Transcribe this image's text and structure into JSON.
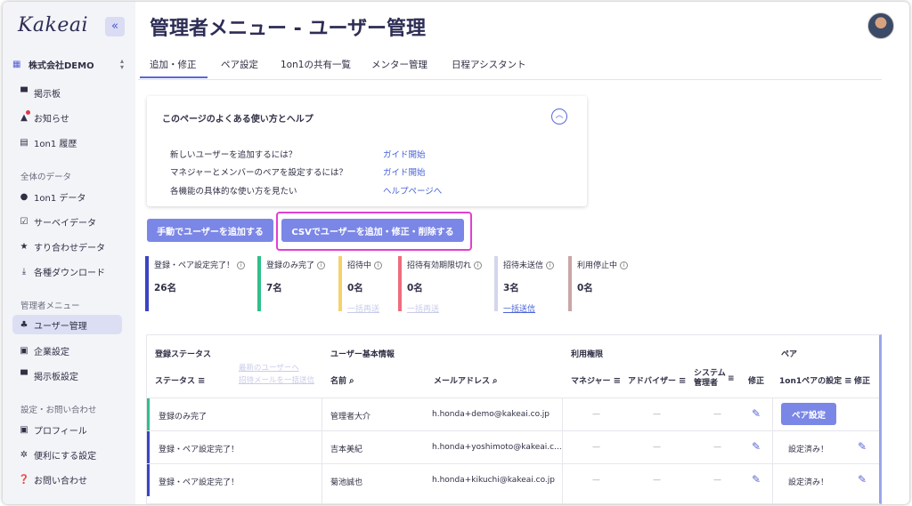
{
  "app": {
    "logo": "Kakeai",
    "collapse_icon": "«"
  },
  "sidebar": {
    "company": "株式会社DEMO",
    "items": [
      {
        "label": "掲示板",
        "icon": "board-icon"
      },
      {
        "label": "お知らせ",
        "icon": "bell-icon"
      },
      {
        "label": "1on1 履歴",
        "icon": "history-icon"
      }
    ],
    "sections": [
      {
        "title": "全体のデータ",
        "items": [
          {
            "label": "1on1 データ",
            "icon": "people-icon"
          },
          {
            "label": "サーベイデータ",
            "icon": "survey-icon"
          },
          {
            "label": "すり合わせデータ",
            "icon": "pin-icon"
          },
          {
            "label": "各種ダウンロード",
            "icon": "download-icon"
          }
        ]
      },
      {
        "title": "管理者メニュー",
        "items": [
          {
            "label": "ユーザー管理",
            "icon": "user-manage-icon",
            "active": true
          },
          {
            "label": "企業設定",
            "icon": "company-settings-icon"
          },
          {
            "label": "掲示板設定",
            "icon": "board-settings-icon"
          }
        ]
      },
      {
        "title": "設定・お問い合わせ",
        "items": [
          {
            "label": "プロフィール",
            "icon": "profile-icon"
          },
          {
            "label": "便利にする設定",
            "icon": "gear-icon"
          },
          {
            "label": "お問い合わせ",
            "icon": "help-icon"
          }
        ]
      }
    ]
  },
  "header": {
    "title": "管理者メニュー - ユーザー管理"
  },
  "tabs": [
    {
      "label": "追加・修正",
      "active": true
    },
    {
      "label": "ペア設定"
    },
    {
      "label": "1on1の共有一覧"
    },
    {
      "label": "メンター管理"
    },
    {
      "label": "日程アシスタント"
    }
  ],
  "help": {
    "title": "このページのよくある使い方とヘルプ",
    "rows": [
      {
        "question": "新しいユーザーを追加するには？",
        "link": "ガイド開始"
      },
      {
        "question": "マネジャーとメンバーのペアを設定するには？",
        "link": "ガイド開始"
      },
      {
        "question": "各機能の具体的な使い方を見たい",
        "link": "ヘルプページへ"
      }
    ]
  },
  "actions": {
    "manual_add": "手動でユーザーを追加する",
    "csv": "CSVでユーザーを追加・修正・削除する"
  },
  "stats": [
    {
      "label": "登録・ペア設定完了！",
      "value": "26名",
      "color": "#3b44c4",
      "action": ""
    },
    {
      "label": "登録のみ完了",
      "value": "7名",
      "color": "#2fbf8a",
      "action": ""
    },
    {
      "label": "招待中",
      "value": "0名",
      "color": "#f3d36a",
      "action": "一括再送"
    },
    {
      "label": "招待有効期限切れ",
      "value": "0名",
      "color": "#ef6c7c",
      "action": "一括再送"
    },
    {
      "label": "招待未送信",
      "value": "3名",
      "color": "#d3d6ee",
      "action": "一括送信"
    },
    {
      "label": "利用停止中",
      "value": "0名",
      "color": "#c9a6a6",
      "action": ""
    }
  ],
  "table": {
    "groups": {
      "status": "登録ステータス",
      "basic": "ユーザー基本情報",
      "permission": "利用権限",
      "pair": "ペア"
    },
    "headers": {
      "status": "ステータス",
      "name": "名前",
      "email": "メールアドレス",
      "manager": "マネジャー",
      "advisor": "アドバイザー",
      "sysadmin": "システム 管理者",
      "edit": "修正",
      "pair_setting": "1on1ペアの設定",
      "pair_edit": "修正"
    },
    "faded_links": [
      "最新のユーザーへ",
      "招待メールを一括送信"
    ],
    "rows": [
      {
        "status": "登録のみ完了",
        "name": "管理者大介",
        "email": "h.honda+demo@kakeai.co.jp",
        "manager": "—",
        "advisor": "—",
        "sysadmin": "—",
        "pair": "ペア設定",
        "lead_color": "#2fbf8a"
      },
      {
        "status": "登録・ペア設定完了！",
        "name": "吉本美紀",
        "email": "h.honda+yoshimoto@kakeai.c...",
        "manager": "—",
        "advisor": "—",
        "sysadmin": "—",
        "pair": "設定済み！",
        "lead_color": "#3b44c4"
      },
      {
        "status": "登録・ペア設定完了！",
        "name": "菊池誠也",
        "email": "h.honda+kikuchi@kakeai.co.jp",
        "manager": "—",
        "advisor": "—",
        "sysadmin": "—",
        "pair": "設定済み！",
        "lead_color": "#3b44c4"
      }
    ]
  },
  "colors": {
    "accent": "#5a66d8",
    "button": "#7b87e6",
    "highlight": "#e23fd3"
  }
}
